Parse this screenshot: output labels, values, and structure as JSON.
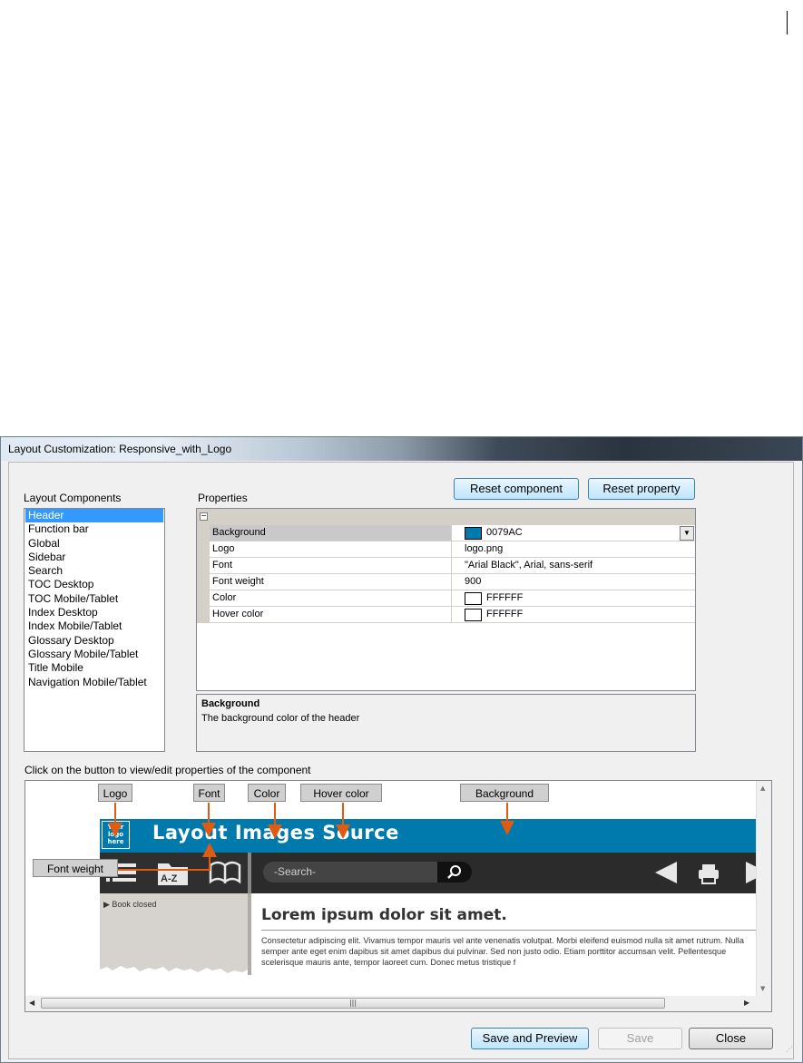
{
  "window": {
    "title": "Layout Customization: Responsive_with_Logo"
  },
  "toolbar": {
    "reset_component": "Reset component",
    "reset_property": "Reset property"
  },
  "components": {
    "label": "Layout Components",
    "items": [
      "Header",
      "Function bar",
      "Global",
      "Sidebar",
      "Search",
      "TOC Desktop",
      "TOC Mobile/Tablet",
      "Index Desktop",
      "Index Mobile/Tablet",
      "Glossary Desktop",
      "Glossary Mobile/Tablet",
      "Title Mobile",
      "Navigation Mobile/Tablet"
    ],
    "selected": "Header"
  },
  "properties": {
    "label": "Properties",
    "rows": [
      {
        "name": "Background",
        "value": "0079AC",
        "swatch": "#0079AC",
        "selected": true
      },
      {
        "name": "Logo",
        "value": "logo.png"
      },
      {
        "name": "Font",
        "value": "\"Arial Black\", Arial, sans-serif"
      },
      {
        "name": "Font weight",
        "value": "900"
      },
      {
        "name": "Color",
        "value": "FFFFFF",
        "swatch": "#FFFFFF"
      },
      {
        "name": "Hover color",
        "value": "FFFFFF",
        "swatch": "#FFFFFF"
      }
    ]
  },
  "description": {
    "title": "Background",
    "text": "The background color of the header"
  },
  "preview": {
    "instruction": "Click on the button to view/edit properties of the component",
    "buttons": [
      "Logo",
      "Font",
      "Color",
      "Hover color",
      "Background",
      "Font weight"
    ],
    "header_title": "Layout Images Source",
    "logo_text": "Your logo here",
    "search_placeholder": "-Search-",
    "sidebar_text": "Book closed",
    "content_heading": "Lorem ipsum dolor sit amet.",
    "content_text": "Consectetur adipiscing elit. Vivamus tempor mauris vel ante venenatis volutpat. Morbi eleifend euismod nulla sit amet rutrum. Nulla semper ante eget enim dapibus sit amet dapibus dui pulvinar. Sed non justo odio. Etiam porttitor accumsan velit. Pellentesque scelerisque mauris ante, tempor laoreet cum. Donec metus tristique f",
    "accent_color": "#0079ac",
    "arrow_color": "#e05a10"
  },
  "footer": {
    "save_preview": "Save and Preview",
    "save": "Save",
    "close": "Close"
  }
}
